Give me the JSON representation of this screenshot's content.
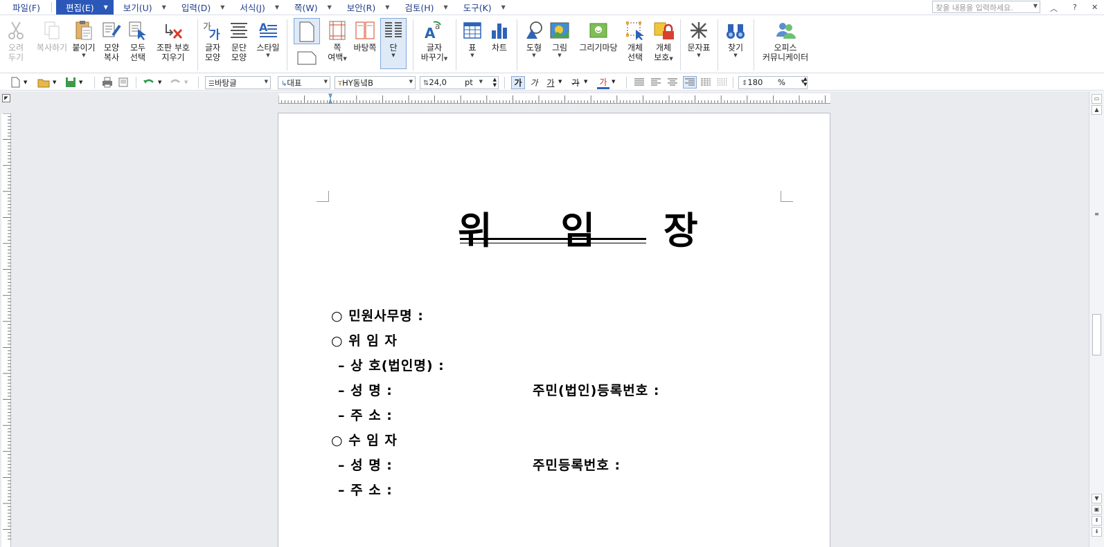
{
  "menu": {
    "items": [
      {
        "label": "파일(F)"
      },
      {
        "label": "편집(E)"
      },
      {
        "label": "보기(U)"
      },
      {
        "label": "입력(D)"
      },
      {
        "label": "서식(J)"
      },
      {
        "label": "쪽(W)"
      },
      {
        "label": "보안(R)"
      },
      {
        "label": "검토(H)"
      },
      {
        "label": "도구(K)"
      }
    ],
    "search_placeholder": "찾을 내용을 입력하세요.",
    "help": "?"
  },
  "ribbon": {
    "cut": {
      "l1": "오려",
      "l2": "두기"
    },
    "copy": {
      "l1": "복사하기"
    },
    "paste": {
      "l1": "붙이기"
    },
    "format_copy": {
      "l1": "모양",
      "l2": "복사"
    },
    "select_all": {
      "l1": "모두",
      "l2": "선택"
    },
    "clear_codes": {
      "l1": "조판 부호",
      "l2": "지우기"
    },
    "char_shape": {
      "l1": "글자",
      "l2": "모양"
    },
    "para_shape": {
      "l1": "문단",
      "l2": "모양"
    },
    "style": {
      "l1": "스타일"
    },
    "page_margin": {
      "l1": "쪽",
      "l2": "여백"
    },
    "background": {
      "l1": "바탕쪽"
    },
    "column": {
      "l1": "단"
    },
    "replace": {
      "l1": "글자",
      "l2": "바꾸기"
    },
    "table": {
      "l1": "표"
    },
    "chart": {
      "l1": "차트"
    },
    "shape": {
      "l1": "도형"
    },
    "picture": {
      "l1": "그림"
    },
    "draw_wizard": {
      "l1": "그리기마당"
    },
    "obj_select": {
      "l1": "개체",
      "l2": "선택"
    },
    "obj_protect": {
      "l1": "개체",
      "l2": "보호"
    },
    "symbols": {
      "l1": "문자표"
    },
    "find": {
      "l1": "찾기"
    },
    "office_comm": {
      "l1": "오피스",
      "l2": "커뮤니케이터"
    }
  },
  "format": {
    "style_combo": "바탕글",
    "lang_combo": "대표",
    "font_combo": "HY동녘B",
    "size_value": "24,0",
    "size_unit": "pt",
    "zoom_value": "180",
    "zoom_unit": "%",
    "bold": "가",
    "italic": "가",
    "underline": "가",
    "strike": "가",
    "color": "가"
  },
  "document": {
    "title": "위 임 장",
    "lines": [
      "○ 민원사무명 :",
      "○ 위 임 자",
      "– 상   호(법인명) :",
      "– 성   명 :",
      "주민(법인)등록번호 :",
      "– 주   소 :",
      "○ 수 임 자",
      "– 성   명 :",
      "주민등록번호 :",
      "– 주   소 :"
    ]
  },
  "colors": {
    "menu_active": "#2a57b8",
    "menu_text": "#1f3d8a",
    "workspace": "#e9ebef"
  }
}
